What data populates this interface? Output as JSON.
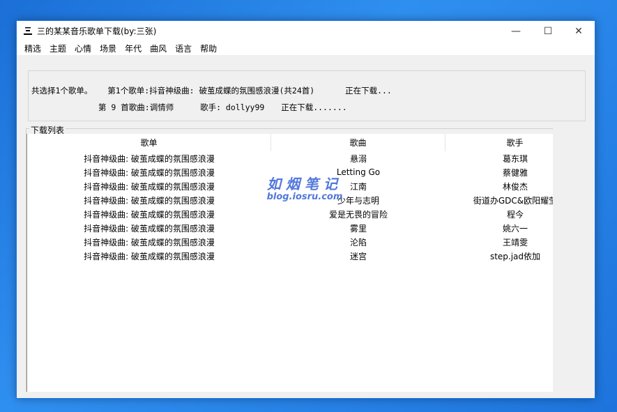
{
  "window": {
    "title": "三的某某音乐歌单下载(by:三张)",
    "controls": {
      "minimize": "—",
      "maximize": "☐",
      "close": "✕"
    }
  },
  "menu": [
    "精选",
    "主题",
    "心情",
    "场景",
    "年代",
    "曲风",
    "语言",
    "帮助"
  ],
  "status": {
    "selected": "共选择1个歌单。",
    "playlist_info": "第1个歌单:抖音神级曲: 破茧成蝶的氛围感浪漫(共24首)",
    "playlist_state": "正在下载...",
    "song_info": "第 9 首歌曲:调情师",
    "singer_info": "歌手: dollyy99",
    "song_state": "正在下载......."
  },
  "download_list": {
    "label": "下载列表",
    "columns": [
      "歌单",
      "歌曲",
      "歌手"
    ],
    "rows": [
      [
        "抖音神级曲: 破茧成蝶的氛围感浪漫",
        "悬溺",
        "葛东琪"
      ],
      [
        "抖音神级曲: 破茧成蝶的氛围感浪漫",
        "Letting Go",
        "蔡健雅"
      ],
      [
        "抖音神级曲: 破茧成蝶的氛围感浪漫",
        "江南",
        "林俊杰"
      ],
      [
        "抖音神级曲: 破茧成蝶的氛围感浪漫",
        "少年与志明",
        "街道办GDC&欧阳耀莹"
      ],
      [
        "抖音神级曲: 破茧成蝶的氛围感浪漫",
        "爱是无畏的冒险",
        "程今"
      ],
      [
        "抖音神级曲: 破茧成蝶的氛围感浪漫",
        "雾里",
        "姚六一"
      ],
      [
        "抖音神级曲: 破茧成蝶的氛围感浪漫",
        "沦陷",
        "王靖雯"
      ],
      [
        "抖音神级曲: 破茧成蝶的氛围感浪漫",
        "迷宫",
        "step.jad依加"
      ]
    ]
  },
  "watermark": {
    "main": "如烟笔记",
    "sub": "blog.iosru.com"
  },
  "colors": {
    "accent": "#1a73e8",
    "watermark": "#3561d6",
    "window_bg": "#f0f0f0"
  }
}
